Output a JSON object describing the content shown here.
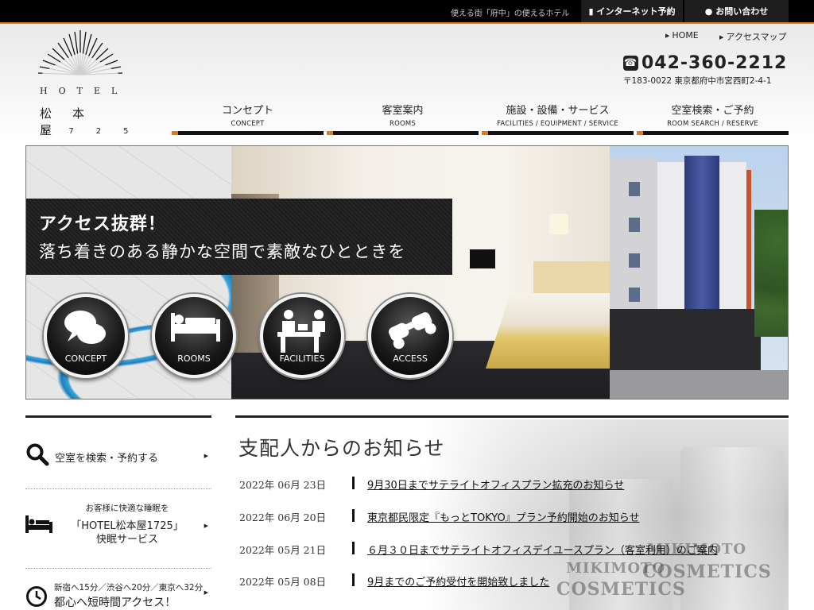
{
  "topbar": {
    "tagline": "便える街「府中」の便えるホテル",
    "reserve_label": "インターネット予約",
    "contact_label": "お問い合わせ"
  },
  "logo": {
    "hotel": "HOTEL",
    "name": "松本屋",
    "year": "1725"
  },
  "utilnav": {
    "home": "HOME",
    "access_map": "アクセスマップ"
  },
  "contact": {
    "phone": "042-360-2212",
    "address": "〒183-0022 東京都府中市宮西町2-4-1"
  },
  "mainnav": [
    {
      "jp": "コンセプト",
      "en": "CONCEPT"
    },
    {
      "jp": "客室案内",
      "en": "ROOMS"
    },
    {
      "jp": "施設・設備・サービス",
      "en": "FACILITIES / EQUIPMENT / SERVICE"
    },
    {
      "jp": "空室検索・ご予約",
      "en": "ROOM SEARCH / RESERVE"
    }
  ],
  "hero": {
    "headline": "アクセス抜群！",
    "subline": "落ち着きのある静かな空間で素敵なひとときを",
    "circles": [
      "CONCEPT",
      "ROOMS",
      "FACILITIES",
      "ACCESS"
    ]
  },
  "sidebar": {
    "search": "空室を検索・予約する",
    "sleep_small": "お客様に快適な睡眠を",
    "sleep_mid": "「HOTEL松本屋1725」",
    "sleep_big": "快眠サービス",
    "access_small": "新宿へ15分／渋谷へ20分／東京へ32分",
    "access_big": "都心へ短時間アクセス！"
  },
  "news": {
    "title": "支配人からのお知らせ",
    "deco": [
      "MIKIMOTO",
      "COSMETICS",
      "MIKIMOTO",
      "COSMETICS"
    ],
    "items": [
      {
        "date": "2022年 06月 23日",
        "text": "9月30日までサテライトオフィスプラン拡充のお知らせ"
      },
      {
        "date": "2022年 06月 20日",
        "text": "東京都民限定『もっとTOKYO』プラン予約開始のお知らせ"
      },
      {
        "date": "2022年 05月 21日",
        "text": "６月３０日までサテライトオフィスデイユースプラン（客室利用）のご案内"
      },
      {
        "date": "2022年 05月 08日",
        "text": "9月までのご予約受付を開始致しました"
      }
    ]
  },
  "colors": {
    "accent": "#e07a16",
    "topbar": "#000000"
  }
}
